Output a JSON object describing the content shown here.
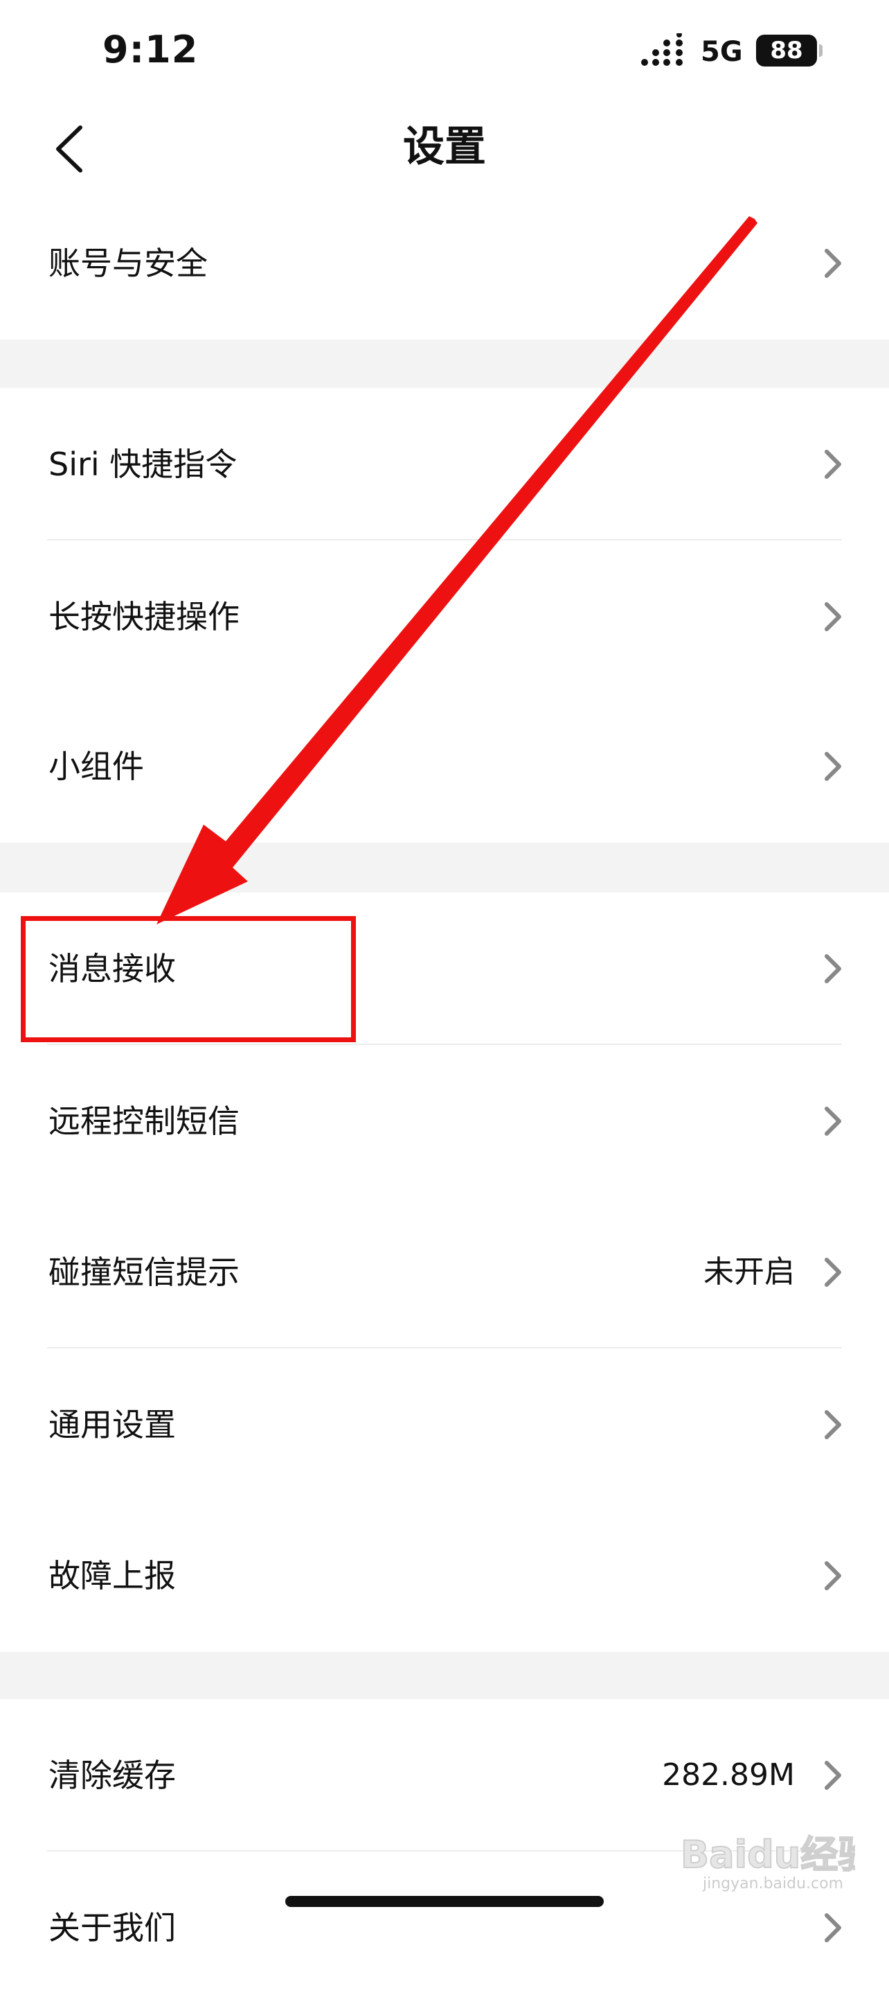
{
  "status_bar": {
    "time": "9:12",
    "network": "5G",
    "battery": "88"
  },
  "nav": {
    "title": "设置",
    "back_icon": "chevron-left-icon"
  },
  "items": [
    {
      "label": "账号与安全",
      "value": ""
    },
    {
      "label": "Siri 快捷指令",
      "value": ""
    },
    {
      "label": "长按快捷操作",
      "value": ""
    },
    {
      "label": "小组件",
      "value": ""
    },
    {
      "label": "消息接收",
      "value": ""
    },
    {
      "label": "远程控制短信",
      "value": ""
    },
    {
      "label": "碰撞短信提示",
      "value": "未开启"
    },
    {
      "label": "通用设置",
      "value": ""
    },
    {
      "label": "故障上报",
      "value": ""
    },
    {
      "label": "清除缓存",
      "value": "282.89M"
    },
    {
      "label": "关于我们",
      "value": ""
    }
  ],
  "annotation": {
    "color": "#ee1111",
    "target": "消息接收"
  },
  "colors": {
    "background": "#ffffff",
    "section_gap": "#f3f3f3",
    "chevron": "#888888",
    "text": "#111111"
  }
}
